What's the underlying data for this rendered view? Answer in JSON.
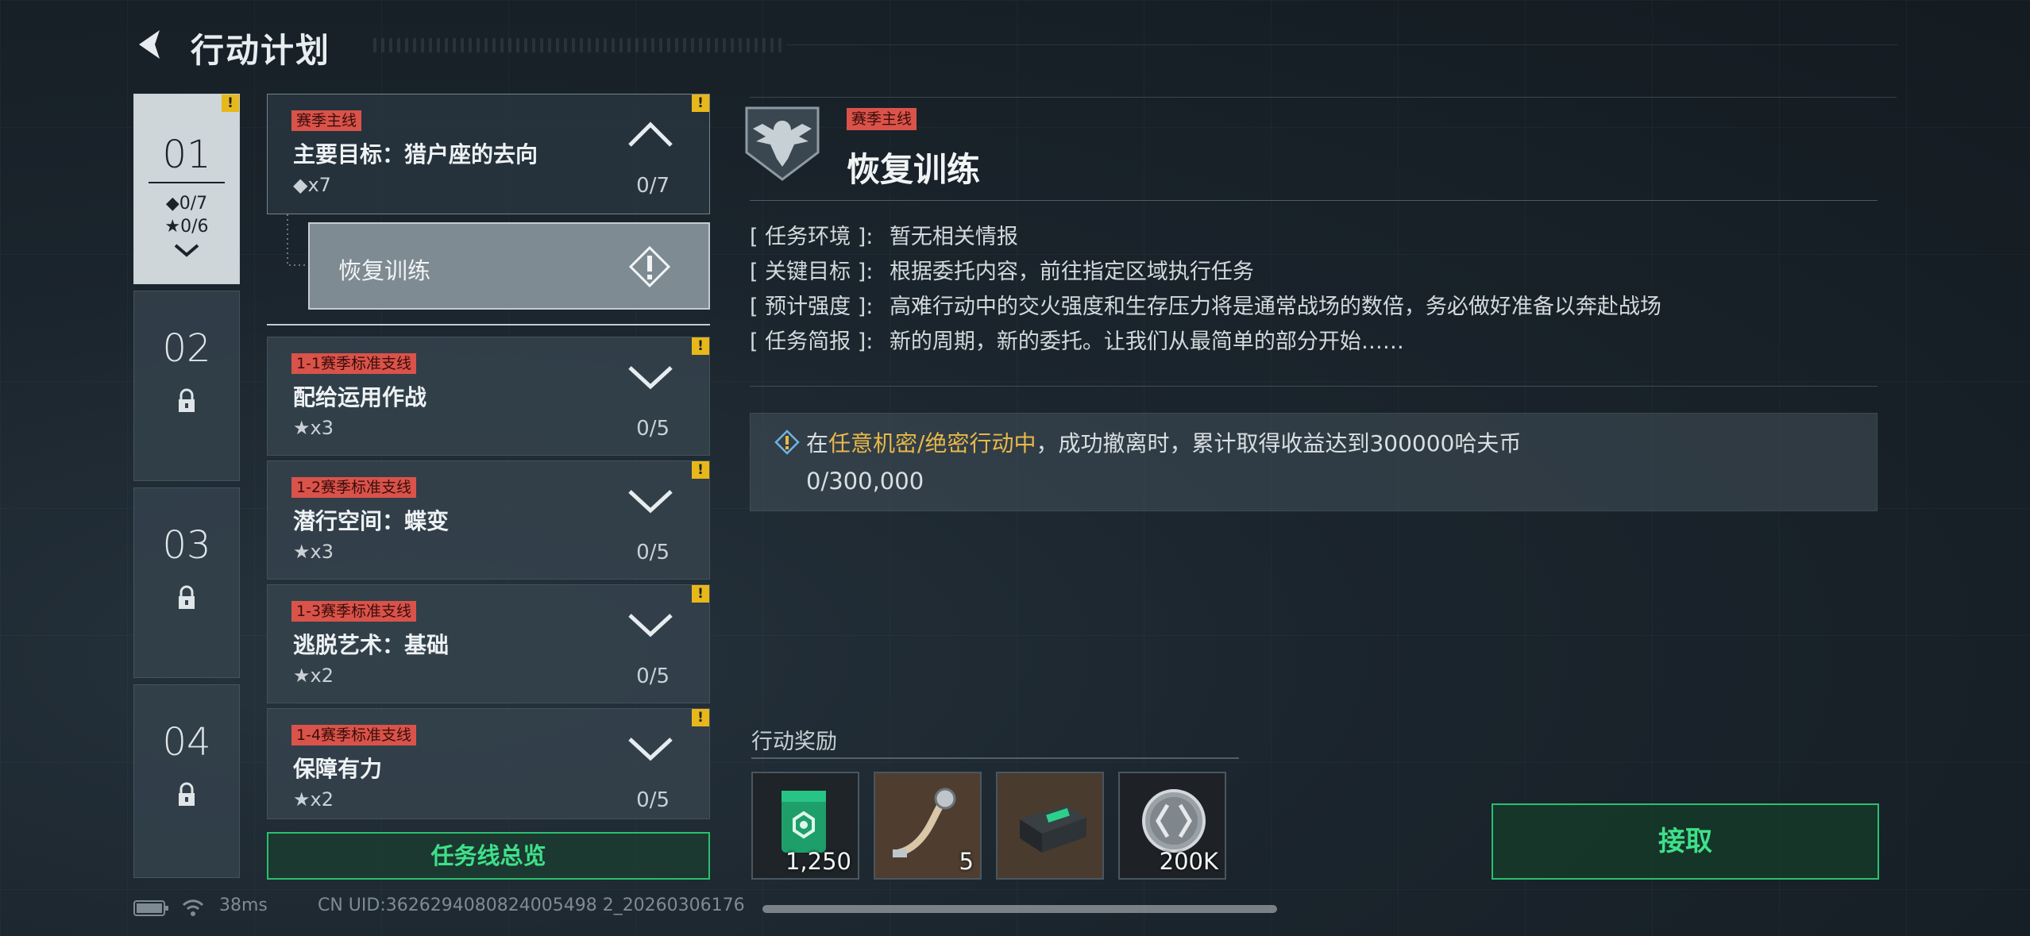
{
  "header": {
    "title": "行动计划"
  },
  "chapters": [
    {
      "num": "01",
      "diamond_stat": "◆0/7",
      "star_stat": "★0/6",
      "badge": "!"
    },
    {
      "num": "02"
    },
    {
      "num": "03"
    },
    {
      "num": "04"
    }
  ],
  "missions": {
    "main": {
      "tag": "赛季主线",
      "title": "主要目标：猎户座的去向",
      "reward": "◆x7",
      "progress": "0/7",
      "badge": "!"
    },
    "sub_item": {
      "title": "恢复训练"
    },
    "branches": [
      {
        "tag": "1-1赛季标准支线",
        "title": "配给运用作战",
        "reward": "★x3",
        "progress": "0/5",
        "badge": "!"
      },
      {
        "tag": "1-2赛季标准支线",
        "title": "潜行空间：蝶变",
        "reward": "★x3",
        "progress": "0/5",
        "badge": "!"
      },
      {
        "tag": "1-3赛季标准支线",
        "title": "逃脱艺术：基础",
        "reward": "★x2",
        "progress": "0/5",
        "badge": "!"
      },
      {
        "tag": "1-4赛季标准支线",
        "title": "保障有力",
        "reward": "★x2",
        "progress": "0/5",
        "badge": "!"
      }
    ],
    "overview_label": "任务线总览"
  },
  "detail": {
    "tag": "赛季主线",
    "title": "恢复训练",
    "info": [
      {
        "label": "[ 任务环境 ]:",
        "value": "暂无相关情报"
      },
      {
        "label": "[ 关键目标 ]:",
        "value": "根据委托内容，前往指定区域执行任务"
      },
      {
        "label": "[ 预计强度 ]:",
        "value": "高难行动中的交火强度和生存压力将是通常战场的数倍，务必做好准备以奔赴战场"
      },
      {
        "label": "[ 任务简报 ]:",
        "value": "新的周期，新的委托。让我们从最简单的部分开始……"
      }
    ],
    "objective": {
      "prefix": "在",
      "highlight": "任意机密/绝密行动中",
      "suffix": "，成功撤离时，累计取得收益达到300000哈夫币",
      "progress": "0/300,000"
    },
    "rewards_label": "行动奖励",
    "rewards": [
      {
        "icon": "green-case-icon",
        "count": "1,250"
      },
      {
        "icon": "cable-part-icon",
        "count": "5"
      },
      {
        "icon": "device-box-icon",
        "count": ""
      },
      {
        "icon": "silver-coin-icon",
        "count": "200K"
      }
    ],
    "accept_label": "接取"
  },
  "status_bar": {
    "ping": "38ms",
    "uid": "CN UID:3626294080824005498 2_20260306176"
  },
  "colors": {
    "accent_green": "#3fe08a",
    "tag_red": "#d9534a",
    "warning_yellow": "#e8b81a",
    "highlight_gold": "#e8b84a"
  }
}
